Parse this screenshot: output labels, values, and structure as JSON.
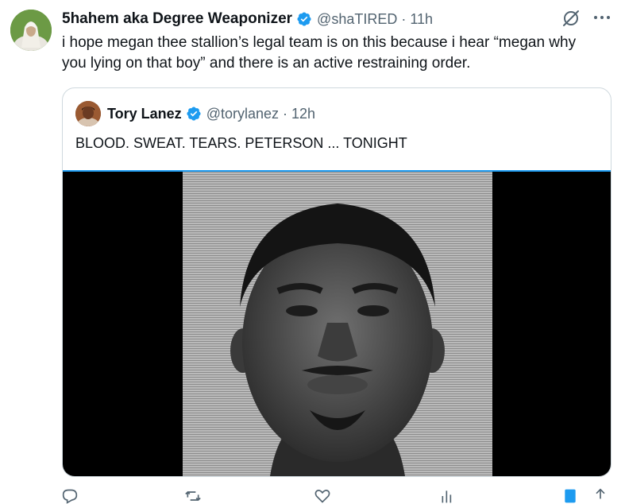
{
  "tweet": {
    "author": {
      "display_name": "5hahem aka Degree Weaponizer",
      "handle": "@shaTIRED",
      "time": "11h"
    },
    "separator": "·",
    "text": "i hope megan thee stallion’s legal team is on this because i hear “megan why you lying on that boy” and there is an active restraining order."
  },
  "quoted": {
    "author": {
      "display_name": "Tory Lanez",
      "handle": "@torylanez",
      "time": "12h"
    },
    "separator": "·",
    "text": "BLOOD. SWEAT. TEARS. PETERSON ... TONIGHT"
  },
  "actions": {
    "reply_count": "",
    "repost_count": "",
    "like_count": "",
    "views_count": ""
  },
  "icons": {
    "verified": "verified-badge-icon",
    "grok": "grok-icon",
    "more": "more-icon",
    "reply": "reply-icon",
    "repost": "repost-icon",
    "like": "like-icon",
    "views": "views-icon",
    "bookmark": "bookmark-icon",
    "share": "share-icon"
  },
  "colors": {
    "text": "#0f1419",
    "secondary": "#536471",
    "verified": "#1d9bf0",
    "border": "#cfd9de"
  }
}
